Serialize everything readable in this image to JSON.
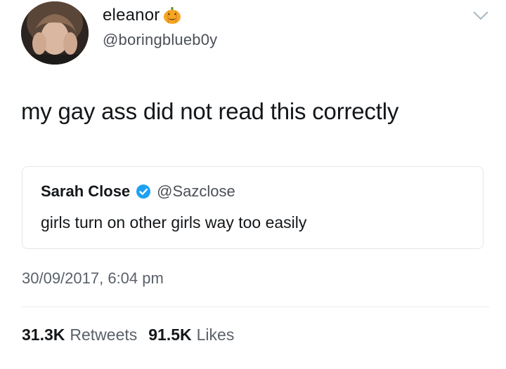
{
  "author": {
    "display_name": "eleanor",
    "name_emoji": "jack-o-lantern-icon",
    "handle": "@boringblueb0y"
  },
  "tweet": {
    "text": "my gay ass did not read this correctly",
    "timestamp": "30/09/2017, 6:04 pm"
  },
  "quoted_tweet": {
    "display_name": "Sarah Close",
    "verified": true,
    "handle": "@Sazclose",
    "text": "girls turn on other girls way too easily"
  },
  "stats": {
    "retweets_count": "31.3K",
    "retweets_label": "Retweets",
    "likes_count": "91.5K",
    "likes_label": "Likes"
  },
  "colors": {
    "verified_blue": "#1da1f2",
    "pumpkin_orange": "#f5a623",
    "secondary_text": "#5b6169",
    "border": "#e1e8ed"
  }
}
